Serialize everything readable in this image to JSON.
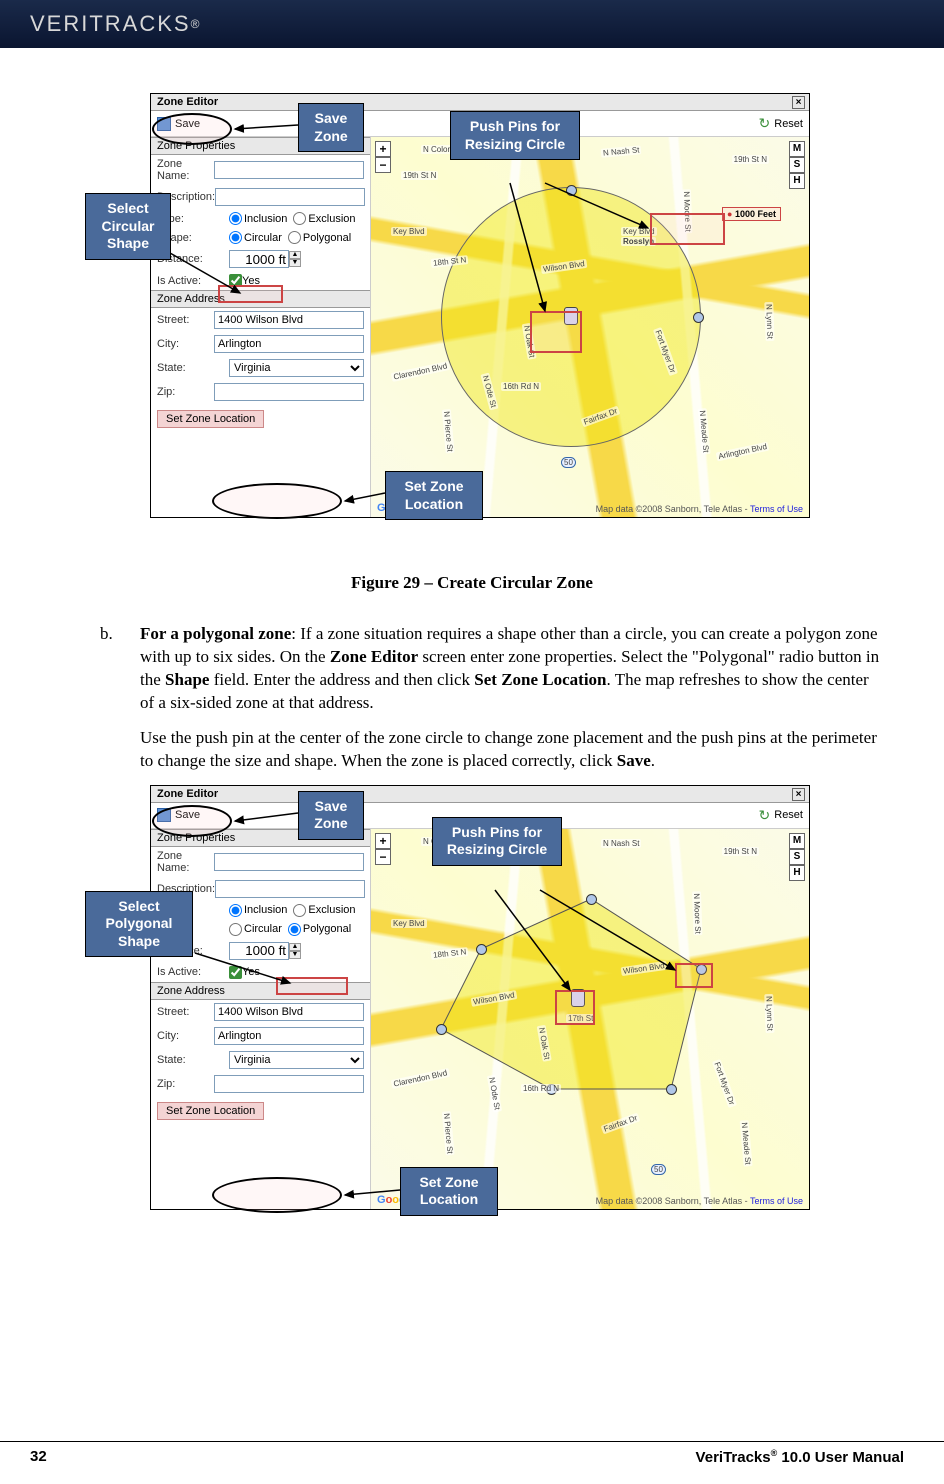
{
  "header": {
    "brand": "VERITRACKS",
    "reg": "®"
  },
  "figure1": {
    "editor_title": "Zone Editor",
    "save_label": "Save",
    "reset_label": "Reset",
    "section_props": "Zone Properties",
    "section_addr": "Zone Address",
    "labels": {
      "zone_name": "Zone Name:",
      "description": "Description:",
      "type": "Type:",
      "shape": "Shape:",
      "distance": "Distance:",
      "is_active": "Is Active:",
      "street": "Street:",
      "city": "City:",
      "state": "State:",
      "zip": "Zip:"
    },
    "type_inclusion": "Inclusion",
    "type_exclusion": "Exclusion",
    "shape_circular": "Circular",
    "shape_polygonal": "Polygonal",
    "distance_value": "1000 ft",
    "active_yes": "Yes",
    "street_value": "1400 Wilson Blvd",
    "city_value": "Arlington",
    "state_value": "Virginia",
    "zip_value": "",
    "set_loc_btn": "Set Zone Location",
    "scale_label": "1000 Feet",
    "attrib": "Map data ©2008 Sanborn, Tele Atlas - ",
    "terms": "Terms of Use",
    "roads": {
      "r1": "N Colonial Ter",
      "r2": "N Nash St",
      "r3": "19th St N",
      "r4": "Key Blvd",
      "r5": "18th St N",
      "r6": "Wilson Blvd",
      "r7": "Rosslyn",
      "r8": "N Oak St",
      "r9": "Clarendon Blvd",
      "r10": "N Ode St",
      "r11": "16th Rd N",
      "r12": "N Pierce St",
      "r13": "Fairfax Dr",
      "r14": "Fort Myer Dr",
      "r15": "N Meade St",
      "r16": "N Lynn St",
      "r17": "Arlington Blvd",
      "r18": "N Moore St",
      "r19": "Key Blvd",
      "r20": "50"
    },
    "callouts": {
      "save": "Save Zone",
      "pushpins": "Push Pins for Resizing Circle",
      "circular": "Select Circular Shape",
      "setloc": "Set Zone Location"
    },
    "caption": "Figure 29 – Create Circular Zone"
  },
  "body": {
    "item": "b.",
    "p1_lead": "For a polygonal zone",
    "p1_rest1": ": If a zone situation requires a shape other than a circle, you can create a polygon zone with up to six sides. On the ",
    "p1_bold2": "Zone Editor",
    "p1_rest2": " screen enter zone properties. Select the \"Polygonal\" radio button in the ",
    "p1_bold3": "Shape",
    "p1_rest3": " field. Enter the address and then click ",
    "p1_bold4": "Set Zone Location",
    "p1_rest4": ". The map refreshes to show the center of a six-sided zone at that address.",
    "p2_a": "Use the push pin at the center of the zone circle to change zone placement and the push pins at the perimeter to change the size and shape.  When the zone is placed correctly, click ",
    "p2_bold": "Save",
    "p2_b": "."
  },
  "figure2": {
    "callouts": {
      "save": "Save Zone",
      "pushpins": "Push Pins for Resizing Circle",
      "polygonal": "Select Polygonal Shape",
      "setloc": "Set Zone Location"
    },
    "roads": {
      "r17": "17th St"
    }
  },
  "footer": {
    "page": "32",
    "title_a": "VeriTracks",
    "title_sup": "®",
    "title_b": " 10.0 User Manual"
  }
}
